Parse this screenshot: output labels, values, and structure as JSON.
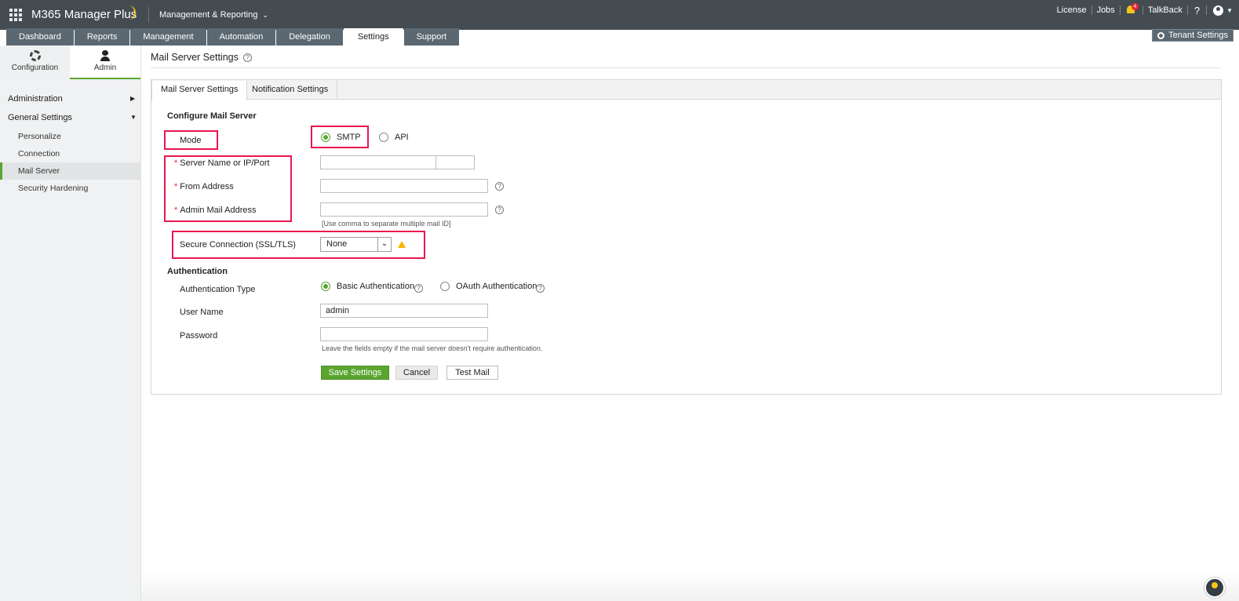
{
  "app": {
    "title": "M365 Manager Plus",
    "menu_dropdown": "Management & Reporting"
  },
  "top_links": {
    "license": "License",
    "jobs": "Jobs",
    "notification_count": "4",
    "talkback": "TalkBack",
    "help": "?"
  },
  "tabs": [
    "Dashboard",
    "Reports",
    "Management",
    "Automation",
    "Delegation",
    "Settings",
    "Support"
  ],
  "tenant_settings": "Tenant Settings",
  "sidebar": {
    "configuration": "Configuration",
    "admin": "Admin",
    "groups": [
      "Administration",
      "General Settings"
    ],
    "items": [
      "Personalize",
      "Connection",
      "Mail Server",
      "Security Hardening"
    ],
    "active_item": "Mail Server"
  },
  "page": {
    "title": "Mail Server Settings"
  },
  "panel_tabs": [
    "Mail Server Settings",
    "Notification Settings"
  ],
  "form": {
    "configure_heading": "Configure Mail Server",
    "mode_label": "Mode",
    "mode_options": [
      "SMTP",
      "API"
    ],
    "mode_selected": "SMTP",
    "server_label": "Server Name or IP/Port",
    "server_value": "",
    "port_value": "",
    "from_label": "From Address",
    "from_value": "",
    "admin_mail_label": "Admin Mail Address",
    "admin_mail_value": "",
    "admin_mail_hint": "[Use comma to separate multiple mail ID]",
    "secure_label": "Secure Connection (SSL/TLS)",
    "secure_value": "None",
    "auth_heading": "Authentication",
    "auth_type_label": "Authentication Type",
    "auth_options": [
      "Basic Authentication",
      "OAuth Authentication"
    ],
    "auth_selected": "Basic Authentication",
    "username_label": "User Name",
    "username_value": "admin",
    "password_label": "Password",
    "password_value": "",
    "auth_hint": "Leave the fields empty if the mail server doesn't require authentication.",
    "save_button": "Save Settings",
    "cancel_button": "Cancel",
    "test_button": "Test Mail"
  },
  "colors": {
    "topbar": "#444c52",
    "accent_green": "#5aa52f",
    "highlight_red": "#e8174f",
    "warning": "#f5b800"
  }
}
